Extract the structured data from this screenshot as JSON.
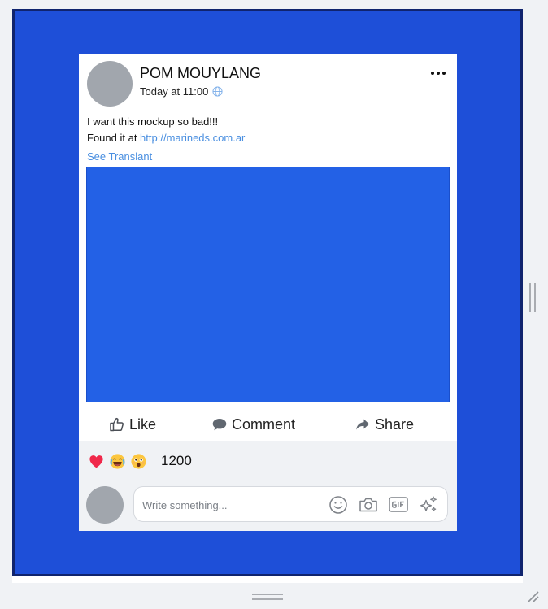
{
  "post": {
    "author": "POM MOUYLANG",
    "timestamp": "Today at 11:00",
    "privacy_icon": "globe-icon",
    "more_icon": "more-options-icon",
    "text_line1": "I want this mockup so bad!!!",
    "text_line2_prefix": "Found it at ",
    "link": "http://marineds.com.ar",
    "translate_label": "See Translant",
    "media_color": "#2361e6"
  },
  "actions": {
    "like_label": "Like",
    "comment_label": "Comment",
    "share_label": "Share"
  },
  "reactions": {
    "icons": [
      "heart-icon",
      "laughing-emoji-icon",
      "astonished-emoji-icon"
    ],
    "count": "1200"
  },
  "comment_box": {
    "placeholder": "Write something...",
    "icons": [
      "smiley-icon",
      "camera-icon",
      "gif-icon",
      "sparkles-icon"
    ]
  },
  "colors": {
    "frame_background": "#1e4fd8",
    "frame_border": "#10246e",
    "link": "#4a8fe0"
  }
}
